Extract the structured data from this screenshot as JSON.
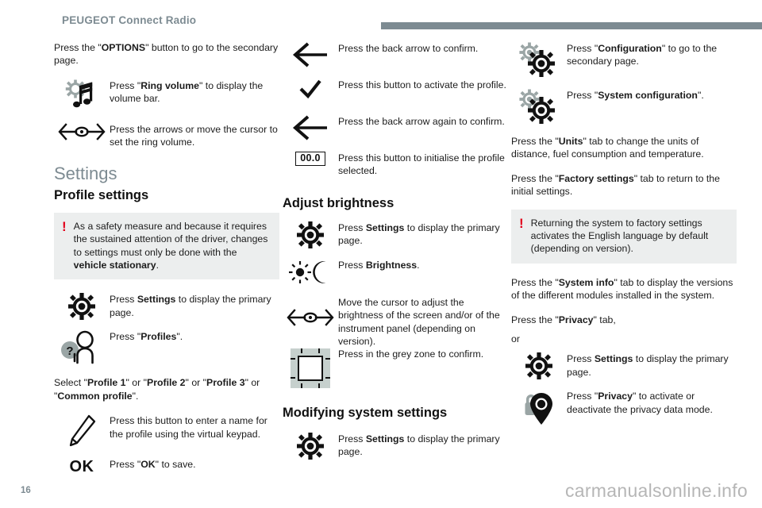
{
  "header": {
    "title": "PEUGEOT Connect Radio",
    "bar_color": "#7d8b92"
  },
  "footer": {
    "page_number": "16",
    "watermark": "carmanualsonline.info"
  },
  "colors": {
    "heading_gray_blue": "#7d8b92",
    "warning_red": "#e2001a",
    "warning_box_bg": "#eceeee",
    "icon_gray": "#9aa5a5",
    "grey_zone": "#c6d0cd"
  },
  "column_left": {
    "intro_para": {
      "pre": "Press the \"",
      "bold": "OPTIONS",
      "post": "\" button to go to the secondary page."
    },
    "ring_volume_row": {
      "icon": "gear-music-note-icon",
      "pre": "Press \"",
      "bold": "Ring volume",
      "post": "\" to display the volume bar."
    },
    "cursor_row": {
      "icon": "left-right-cursor-icon",
      "text": "Press the arrows or move the cursor to set the ring volume."
    },
    "section_heading": "Settings",
    "sub_heading": "Profile settings",
    "warning": {
      "pre": "As a safety measure and because it requires the sustained attention of the driver, changes to settings must only be done with the ",
      "bold": "vehicle stationary",
      "post": "."
    },
    "settings_row": {
      "icon": "gear-icon",
      "pre": "Press ",
      "bold": "Settings",
      "post": " to display the primary page."
    },
    "profiles_row": {
      "icon": "person-question-icon",
      "pre": "Press \"",
      "bold": "Profiles",
      "post": "\"."
    },
    "select_para": {
      "p0": "Select \"",
      "b1": "Profile 1",
      "p1": "\" or \"",
      "b2": "Profile 2",
      "p2": "\" or \"",
      "b3": "Profile 3",
      "p3": "\" or \"",
      "b4": "Common profile",
      "p4": "\"."
    },
    "pencil_row": {
      "icon": "pencil-icon",
      "text": "Press this button to enter a name for the profile using the virtual keypad."
    },
    "ok_row": {
      "icon": "ok-text-icon",
      "glyph": "OK",
      "pre": "Press \"",
      "bold": "OK",
      "post": "\" to save."
    }
  },
  "column_middle": {
    "back_arrow_row": {
      "icon": "back-arrow-icon",
      "text": "Press the back arrow to confirm."
    },
    "check_row": {
      "icon": "check-icon",
      "text": "Press this button to activate the profile."
    },
    "back_arrow_again_row": {
      "icon": "back-arrow-icon",
      "text": "Press the back arrow again to confirm."
    },
    "init_row": {
      "icon": "zero-value-box-icon",
      "glyph": "00.0",
      "text": "Press this button to initialise the profile selected."
    },
    "brightness_heading": "Adjust brightness",
    "settings_row": {
      "icon": "gear-icon",
      "pre": "Press ",
      "bold": "Settings",
      "post": " to display the primary page."
    },
    "brightness_row": {
      "icon": "sun-moon-icon",
      "pre": "Press ",
      "bold": "Brightness",
      "post": "."
    },
    "cursor_row": {
      "icon": "left-right-cursor-icon",
      "text": "Move the cursor to adjust the brightness of the screen and/or of the instrument panel (depending on version)."
    },
    "grey_zone_row": {
      "icon": "grey-zone-icon",
      "text": "Press in the grey zone to confirm."
    },
    "modify_heading": "Modifying system settings",
    "settings_row_2": {
      "icon": "gear-icon",
      "pre": "Press ",
      "bold": "Settings",
      "post": " to display the primary page."
    }
  },
  "column_right": {
    "configuration_row": {
      "icon": "double-gear-icon",
      "pre": "Press \"",
      "bold": "Configuration",
      "post": "\" to go to the secondary page."
    },
    "system_config_row": {
      "icon": "double-gear-icon",
      "pre": "Press \"",
      "bold": "System configuration",
      "post": "\"."
    },
    "units_para": {
      "pre": "Press the \"",
      "bold": "Units",
      "post": "\" tab to change the units of distance, fuel consumption and temperature."
    },
    "factory_para": {
      "pre": "Press the \"",
      "bold": "Factory settings",
      "post": "\" tab to return to the initial settings."
    },
    "warning": {
      "text": "Returning the system to factory settings activates the English language by default (depending on version)."
    },
    "system_info_para": {
      "pre": "Press the \"",
      "bold": "System info",
      "post": "\" tab to display the versions of the different modules installed in the system."
    },
    "privacy_tab_para": {
      "pre": "Press the \"",
      "bold": "Privacy",
      "post": "\" tab,"
    },
    "or_text": "or",
    "settings_row": {
      "icon": "gear-icon",
      "pre": "Press ",
      "bold": "Settings",
      "post": " to display the primary page."
    },
    "privacy_row": {
      "icon": "lock-pin-icon",
      "pre": "Press \"",
      "bold": "Privacy",
      "post": "\" to activate or deactivate the privacy data mode."
    }
  }
}
